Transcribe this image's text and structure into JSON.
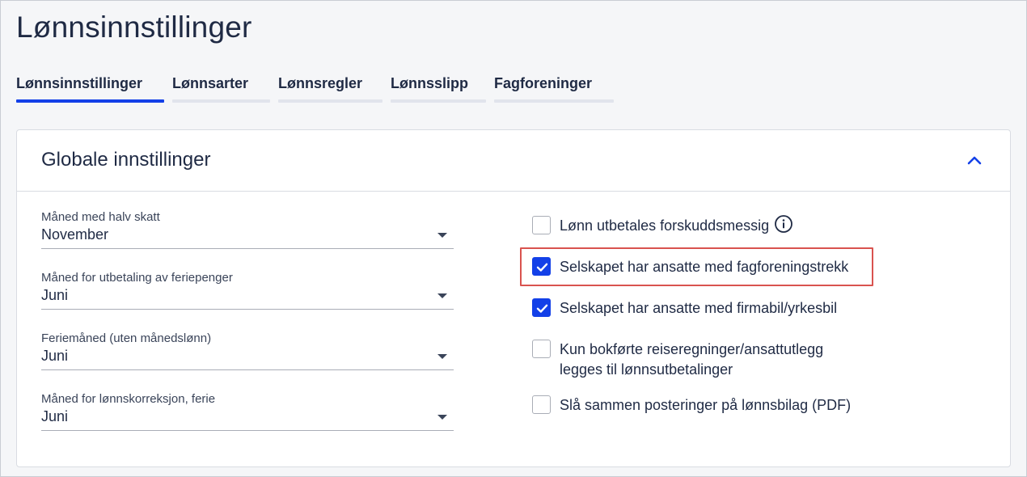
{
  "page": {
    "title": "Lønnsinnstillinger"
  },
  "tabs": [
    {
      "label": "Lønnsinnstillinger",
      "active": true
    },
    {
      "label": "Lønnsarter",
      "active": false
    },
    {
      "label": "Lønnsregler",
      "active": false
    },
    {
      "label": "Lønnsslipp",
      "active": false
    },
    {
      "label": "Fagforeninger",
      "active": false
    }
  ],
  "card": {
    "title": "Globale innstillinger",
    "collapse_icon": "chevron-up-icon"
  },
  "fields": [
    {
      "label": "Måned med halv skatt",
      "value": "November"
    },
    {
      "label": "Måned for utbetaling av feriepenger",
      "value": "Juni"
    },
    {
      "label": "Feriemåned (uten månedslønn)",
      "value": "Juni"
    },
    {
      "label": "Måned for lønnskorreksjon, ferie",
      "value": "Juni"
    }
  ],
  "checkboxes": [
    {
      "label": "Lønn utbetales forskuddsmessig",
      "checked": false,
      "has_info": true
    },
    {
      "label": "Selskapet har ansatte med fagforeningstrekk",
      "checked": true,
      "highlighted": true
    },
    {
      "label": "Selskapet har ansatte med firmabil/yrkesbil",
      "checked": true
    },
    {
      "label_line1": "Kun bokførte reiseregninger/ansattutlegg",
      "label_line2": "legges til lønnsutbetalinger",
      "checked": false
    },
    {
      "label": "Slå sammen posteringer på lønnsbilag (PDF)",
      "checked": false
    }
  ],
  "colors": {
    "accent": "#1340e8",
    "highlight": "#d9534f",
    "text": "#1f2a44"
  }
}
